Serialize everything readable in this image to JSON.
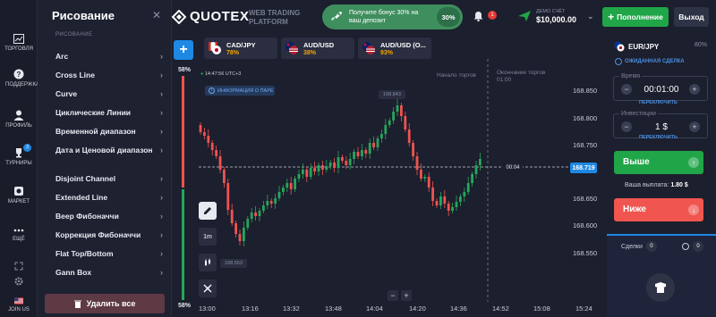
{
  "sidebar": {
    "items": [
      {
        "label": "ТОРГОВЛЯ",
        "icon": "chart-icon"
      },
      {
        "label": "ПОДДЕРЖКА",
        "icon": "question-icon"
      },
      {
        "label": "ПРОФИЛЬ",
        "icon": "user-icon"
      },
      {
        "label": "ТУРНИРЫ",
        "icon": "trophy-icon",
        "badge": "3"
      },
      {
        "label": "МАРКЕТ",
        "icon": "market-icon"
      },
      {
        "label": "ЕЩЁ",
        "icon": "more-icon"
      }
    ],
    "join_label": "JOIN US"
  },
  "drawing_panel": {
    "title": "Рисование",
    "section": "РИСОВАНИЕ",
    "items": [
      "Arc",
      "Cross Line",
      "Curve",
      "Циклические Линии",
      "Временной диапазон",
      "Дата и Ценовой диапазон",
      "Disjoint Channel",
      "Extended Line",
      "Веер Фибоначчи",
      "Коррекция Фибоначчи",
      "Flat Top/Bottom",
      "Gann Box"
    ],
    "delete_label": "Удалить все"
  },
  "header": {
    "logo": "QUOTEX",
    "logo_sub_1": "WEB TRADING",
    "logo_sub_2": "PLATFORM",
    "bonus_text": "Получите бонус 30% на ваш депозит",
    "bonus_pct": "30%",
    "notif_count": "1",
    "account_label": "ДЕМО СЧЁТ",
    "account_balance": "$10,000.00",
    "deposit_label": "Пополнение",
    "exit_label": "Выход"
  },
  "asset_tabs": [
    {
      "name": "CAD/JPY",
      "pct": "78%"
    },
    {
      "name": "AUD/USD",
      "pct": "38%"
    },
    {
      "name": "AUD/USD (O...",
      "pct": "93%"
    }
  ],
  "chart": {
    "sentiment_top": "58%",
    "sentiment_bottom": "58%",
    "time_label": "14:47:56 UTC+3",
    "info_label": "ИНФОРМАЦИЯ О ПАРЕ",
    "label_start": "Начало торгов",
    "label_end_1": "Окончание торгов",
    "label_end_2": "01:00",
    "hi_label": "168.843",
    "lo_label": "168.553",
    "current_price": "168.719",
    "countdown": "00:04",
    "timeframe": "1m",
    "price_ticks": [
      "168.850",
      "168.800",
      "168.750",
      "168.719",
      "168.650",
      "168.600",
      "168.550"
    ],
    "time_ticks": [
      "13:00",
      "13:16",
      "13:32",
      "13:48",
      "14:04",
      "14:20",
      "14:36",
      "14:52",
      "15:08",
      "15:24"
    ]
  },
  "trade_panel": {
    "asset": "EUR/JPY",
    "asset_pct": "80%",
    "mode_label": "ОЖИДАННАЯ СДЕЛКА",
    "time_label": "Время",
    "time_value": "00:01:00",
    "time_switch": "ПЕРЕКЛЮЧИТЬ",
    "invest_label": "Инвестиции",
    "invest_value": "1 $",
    "invest_switch": "ПЕРЕКЛЮЧИТЬ",
    "up_label": "Выше",
    "payout_label": "Ваша выплата:",
    "payout_value": "1.80 $",
    "down_label": "Ниже"
  },
  "trades": {
    "tab_label": "Сделки",
    "tab_count": "0",
    "tab2_count": "0"
  },
  "colors": {
    "green": "#20a548",
    "red": "#f0554f",
    "accent": "#1e88e5"
  }
}
